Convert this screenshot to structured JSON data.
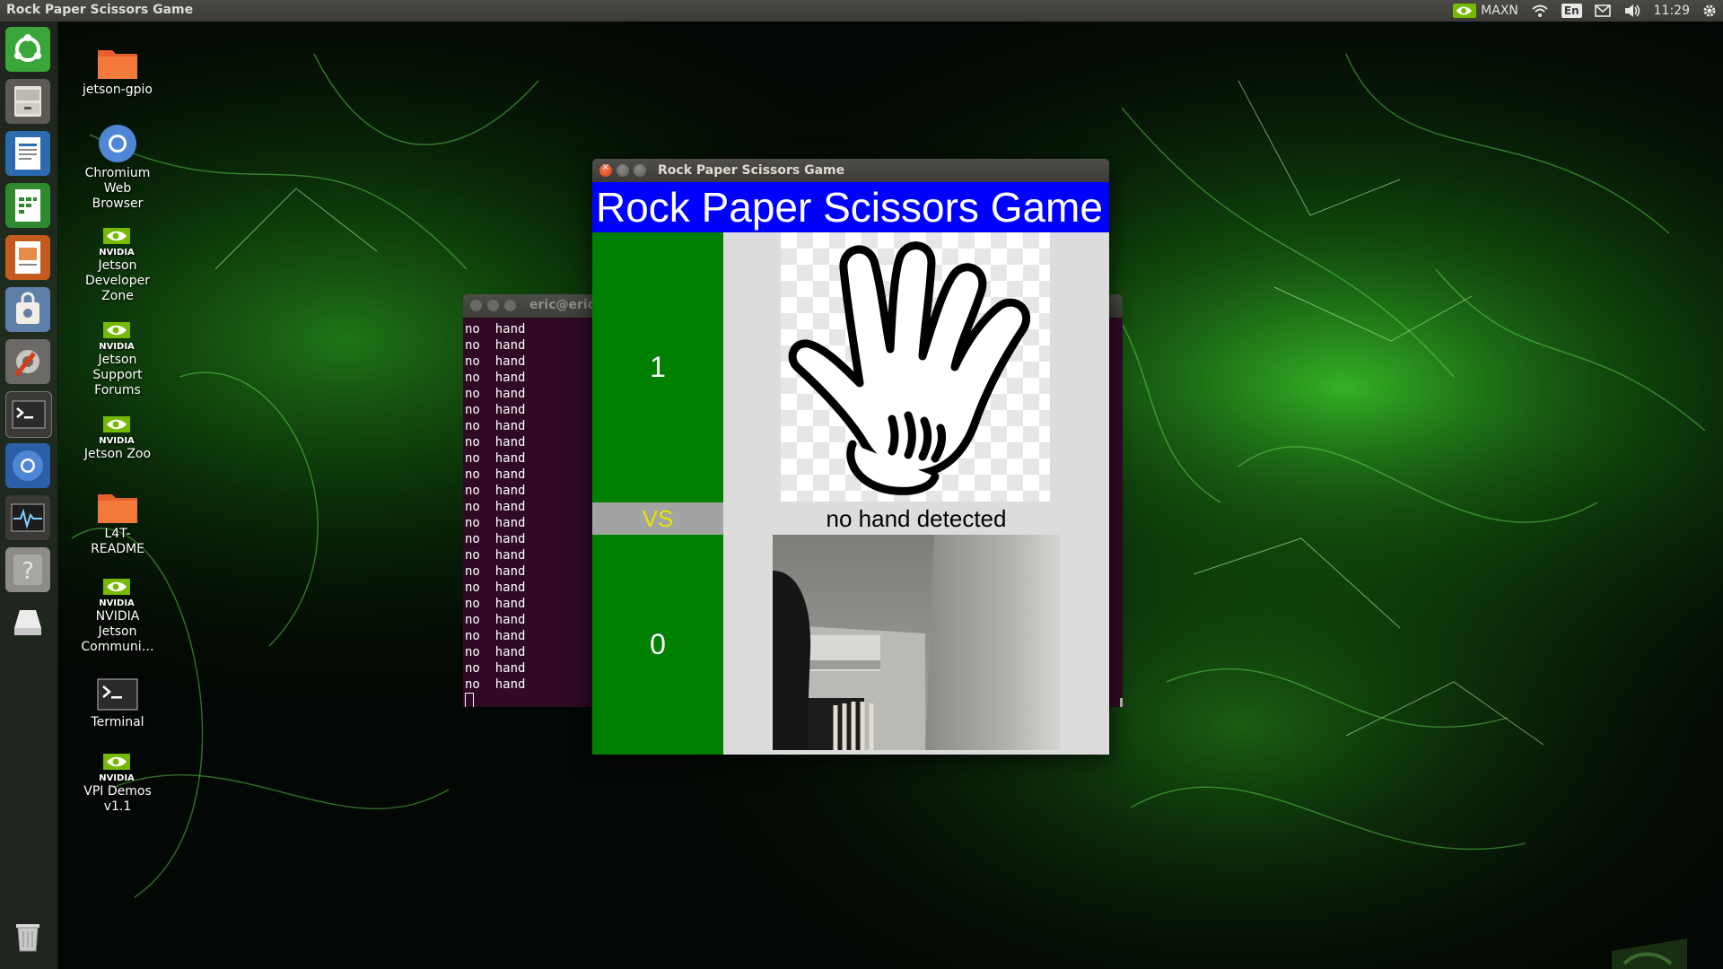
{
  "top_panel": {
    "title": "Rock Paper Scissors Game",
    "tray": {
      "power_mode": "MAXN",
      "keyboard_layout": "En",
      "clock": "11:29"
    }
  },
  "launcher": {
    "items": [
      "dash-home",
      "files",
      "libreoffice-writer",
      "libreoffice-calc",
      "libreoffice-impress",
      "software-center",
      "system-settings",
      "terminal",
      "chromium",
      "system-monitor",
      "help",
      "drive",
      "trash"
    ]
  },
  "desktop": {
    "icons": [
      {
        "label": "jetson-gpio",
        "type": "folder"
      },
      {
        "label": "Chromium\nWeb\nBrowser",
        "type": "chromium"
      },
      {
        "label": "Jetson\nDeveloper\nZone",
        "type": "nvidia"
      },
      {
        "label": "Jetson\nSupport\nForums",
        "type": "nvidia"
      },
      {
        "label": "Jetson Zoo",
        "type": "nvidia"
      },
      {
        "label": "L4T-\nREADME",
        "type": "folder"
      },
      {
        "label": "NVIDIA\nJetson\nCommuni…",
        "type": "nvidia"
      },
      {
        "label": "Terminal",
        "type": "terminal"
      },
      {
        "label": "VPI Demos\nv1.1",
        "type": "nvidia"
      }
    ],
    "nvidia_wordmark": "NVIDIA"
  },
  "terminal": {
    "title": "eric@eric:",
    "line_text": "no  hand",
    "line_count": 23
  },
  "game": {
    "window_title": "Rock Paper Scissors Game",
    "heading": "Rock Paper Scissors Game",
    "score_top": "1",
    "vs_label": "VS",
    "score_bottom": "0",
    "status": "no hand detected",
    "computer_move_icon": "open-hand-paper-icon",
    "colors": {
      "heading_bg": "#0000ff",
      "score_bg": "#008000",
      "vs_bg": "#a3a3a3",
      "vs_text": "#e4e400"
    }
  }
}
